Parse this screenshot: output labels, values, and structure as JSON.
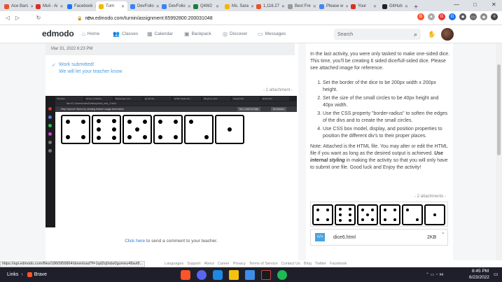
{
  "browser": {
    "tabs": [
      {
        "label": "Ace Barc",
        "color": "#e8542f"
      },
      {
        "label": "Muli - Ai",
        "color": "#d93025"
      },
      {
        "label": "Facebook",
        "color": "#1877f2"
      },
      {
        "label": "Turn",
        "color": "#f2b705",
        "active": true
      },
      {
        "label": "DevFolio",
        "color": "#3b82f6"
      },
      {
        "label": "DevFolio",
        "color": "#3b82f6"
      },
      {
        "label": "Q4W2",
        "color": "#188038"
      },
      {
        "label": "Ms. Sara",
        "color": "#f2b705"
      },
      {
        "label": "1,116.27",
        "color": "#e8542f"
      },
      {
        "label": "Best Fre",
        "color": "#999999"
      },
      {
        "label": "Please w",
        "color": "#4285f4"
      },
      {
        "label": "Your",
        "color": "#d93025"
      },
      {
        "label": "GitHub",
        "color": "#222222"
      }
    ],
    "new_tab": "+",
    "url": "new.edmodo.com/turnin/assignment:65992800:200031048",
    "window_controls": {
      "minimize": "—",
      "maximize": "□",
      "close": "✕"
    },
    "status_url": "https://api.edmodo.com/files/1860956864/download?f=1qd2q0sbs0gumeu48avl8..."
  },
  "app": {
    "logo": "edmodo",
    "nav": [
      {
        "label": "Home",
        "icon": "home-icon",
        "glyph": "⌂"
      },
      {
        "label": "Classes",
        "icon": "classes-icon",
        "glyph": "👥"
      },
      {
        "label": "Calendar",
        "icon": "calendar-icon",
        "glyph": "▦"
      },
      {
        "label": "Backpack",
        "icon": "backpack-icon",
        "glyph": "▣"
      },
      {
        "label": "Discover",
        "icon": "discover-icon",
        "glyph": "◎"
      },
      {
        "label": "Messages",
        "icon": "messages-icon",
        "glyph": "▭"
      }
    ],
    "search_placeholder": "Search"
  },
  "submission": {
    "timestamp": "Mar 31, 2022 6:23 PM",
    "status": "Work submitted!",
    "status_sub": "We will let your teacher know",
    "attachment_count": "- 1 attachment -",
    "comment_link": "Click here",
    "comment_rest": " to send a comment to your teacher."
  },
  "screenshot_inner": {
    "tabs": [
      "YouTube",
      "Home | Ordinary...",
      "Messenger | Fa...",
      "git furnish...",
      "HTML Studio dic...",
      "3D gil up, doin...",
      "Joseph Ditt",
      "dice6.html"
    ],
    "url": "file:///C:/Users/User/Desktop/dice_test_2.html",
    "banner": "Help improve Opera by sending feature usage information",
    "banner_btns": [
      "No, I want to help",
      "No thanks"
    ],
    "dice": [
      4,
      6,
      5,
      4,
      2,
      1
    ]
  },
  "assignment": {
    "intro": "In the last activity, you were only tasked to make one-sided dice. This time, you'll be creating 6 sided dice/full-sided dice. Please see attached image for reference.",
    "steps": [
      "Set the border of the dice to be 200px width x 200px height.",
      "Set the size of the small circles to be 40px height and 40px width.",
      "Use the CSS property \"border-radius\" to soften the edges of the divs and to create the small circles.",
      "Use CSS box model, display, and position properties to position the different div's to their proper places."
    ],
    "note_pre": "Note: Attached is the HTML file. You may alter or edit the HTML file if you want as long as the desired output is achieved. ",
    "note_em": "Use internal styling",
    "note_post": " in making the activity so that you will only have to submit one file. Good luck and Enjoy the activity!",
    "attachments_count": "- 2 attachments -",
    "preview_dice": [
      4,
      6,
      5,
      4,
      2,
      1
    ],
    "file_name": "dice6.html",
    "file_size": "2KB"
  },
  "footer": [
    "Languages",
    "Support",
    "About",
    "Career",
    "Privacy",
    "Terms of Service",
    "Contact Us",
    "Blog",
    "Twitter",
    "Facebook"
  ],
  "taskbar": {
    "links": "Links",
    "brave": "Brave",
    "time": "8:45 PM",
    "date": "6/23/2022"
  }
}
